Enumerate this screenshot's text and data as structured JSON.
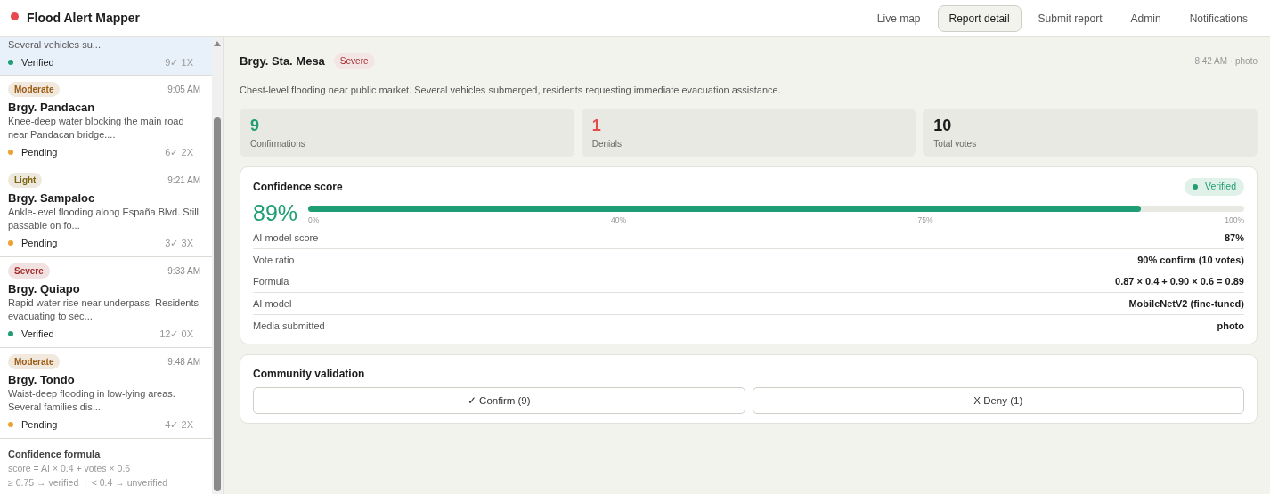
{
  "app": {
    "title": "Flood Alert Mapper",
    "color": "#e5484d"
  },
  "nav": [
    {
      "label": "Live map",
      "selected": false
    },
    {
      "label": "Report detail",
      "selected": true
    },
    {
      "label": "Submit report",
      "selected": false
    },
    {
      "label": "Admin",
      "selected": false
    },
    {
      "label": "Notifications",
      "selected": false
    }
  ],
  "reports": [
    {
      "description": "Several vehicles su...",
      "status": "Verified",
      "color": "#1f9d74",
      "votes": "9✓ 1X",
      "selected": true
    },
    {
      "severity": {
        "label": "Moderate",
        "color": "#9a5a12"
      },
      "time": "9:05 AM",
      "title": "Brgy. Pandacan",
      "description": "Knee-deep water blocking the main road near Pandacan bridge....",
      "status": "Pending",
      "color": "#f0a030",
      "votes": "6✓ 2X",
      "selected": false
    },
    {
      "severity": {
        "label": "Light",
        "color": "#7d6510"
      },
      "time": "9:21 AM",
      "title": "Brgy. Sampaloc",
      "description": "Ankle-level flooding along España Blvd. Still passable on fo...",
      "status": "Pending",
      "color": "#f0a030",
      "votes": "3✓ 3X",
      "selected": false
    },
    {
      "severity": {
        "label": "Severe",
        "color": "#a32a2a"
      },
      "time": "9:33 AM",
      "title": "Brgy. Quiapo",
      "description": "Rapid water rise near underpass. Residents evacuating to sec...",
      "status": "Verified",
      "color": "#1f9d74",
      "votes": "12✓ 0X",
      "selected": false
    },
    {
      "severity": {
        "label": "Moderate",
        "color": "#9a5a12"
      },
      "time": "9:48 AM",
      "title": "Brgy. Tondo",
      "description": "Waist-deep flooding in low-lying areas. Several families dis...",
      "status": "Pending",
      "color": "#f0a030",
      "votes": "4✓ 2X",
      "selected": false
    }
  ],
  "formula_note": {
    "title": "Confidence formula",
    "lines": [
      "score = AI × 0.4 + votes × 0.6",
      "≥ 0.75 → verified  |  < 0.4 → unverified"
    ]
  },
  "detail": {
    "title": "Brgy. Sta. Mesa",
    "severity": {
      "label": "Severe",
      "color": "#a32a2a"
    },
    "meta": "8:42 AM · photo",
    "description": "Chest-level flooding near public market. Several vehicles submerged, residents requesting immediate evacuation assistance.",
    "stats": [
      {
        "value": "9",
        "label": "Confirmations",
        "color": "#1f9d74"
      },
      {
        "value": "1",
        "label": "Denials",
        "color": "#e5484d"
      },
      {
        "value": "10",
        "label": "Total votes",
        "color": "#1c1c1c"
      }
    ],
    "confidence": {
      "title": "Confidence score",
      "badge": "Verified",
      "percent": "89%",
      "level": 0.89,
      "ticks": [
        "0%",
        "40%",
        "75%",
        "100%"
      ],
      "rows": [
        {
          "label": "AI model score",
          "value": "87%"
        },
        {
          "label": "Vote ratio",
          "value": "90% confirm (10 votes)"
        },
        {
          "label": "Formula",
          "value": "0.87 × 0.4 + 0.90 × 0.6 = 0.89"
        },
        {
          "label": "AI model",
          "value": "MobileNetV2 (fine-tuned)"
        },
        {
          "label": "Media submitted",
          "value": "photo"
        }
      ]
    },
    "validation": {
      "title": "Community validation",
      "buttons": [
        "✓ Confirm (9)",
        "X Deny (1)"
      ]
    }
  }
}
